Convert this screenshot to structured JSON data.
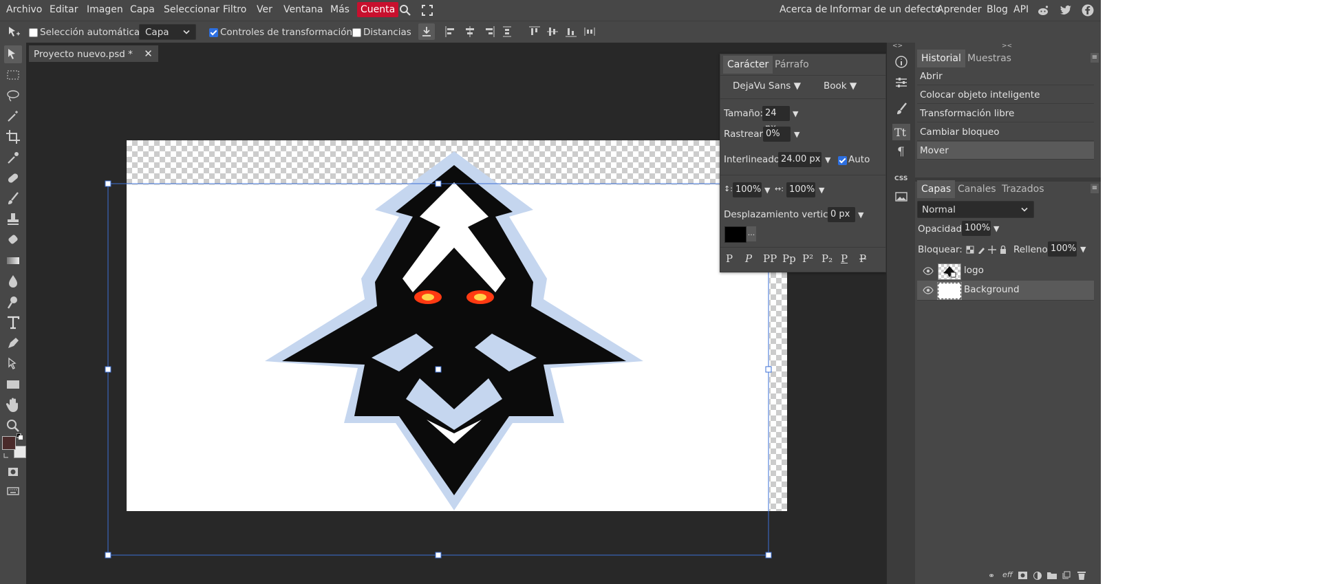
{
  "menubar": {
    "items": [
      "Archivo",
      "Editar",
      "Imagen",
      "Capa",
      "Seleccionar",
      "Filtro",
      "Ver",
      "Ventana",
      "Más",
      "Cuenta"
    ],
    "right_links": [
      "Acerca de",
      "Informar de un defecto",
      "Aprender",
      "Blog",
      "API"
    ],
    "icons": [
      "search-icon",
      "fullscreen-icon",
      "reddit-icon",
      "twitter-icon",
      "facebook-icon"
    ]
  },
  "options": {
    "auto_select_label": "Selección automática",
    "auto_select_checked": false,
    "target_value": "Capa",
    "transform_controls_label": "Controles de transformación",
    "transform_controls_checked": true,
    "distances_label": "Distancias",
    "distances_checked": false
  },
  "document": {
    "tab_title": "Proyecto nuevo.psd *"
  },
  "character_panel": {
    "tabs": [
      "Carácter",
      "Párrafo"
    ],
    "font_family": "DejaVu Sans",
    "font_style": "Book",
    "size_label": "Tamaño:",
    "size_value": "24 px",
    "tracking_label": "Rastrear:",
    "tracking_value": "0%",
    "leading_label": "Interlineado:",
    "leading_value": "24.00 px",
    "leading_auto_label": "Auto",
    "leading_auto_checked": true,
    "vscale_value": "100%",
    "hscale_value": "100%",
    "baseline_label": "Desplazamiento vertical:",
    "baseline_value": "0 px",
    "more_label": "...",
    "color": "#000000",
    "style_buttons": [
      "P",
      "P",
      "PP",
      "Pp",
      "P²",
      "P₂",
      "P",
      "P"
    ]
  },
  "history_panel": {
    "tabs": [
      "Historial",
      "Muestras"
    ],
    "items": [
      "Abrir",
      "Colocar objeto inteligente",
      "Transformación libre",
      "Cambiar bloqueo",
      "Mover"
    ],
    "selected_index": 4
  },
  "layers_panel": {
    "tabs": [
      "Capas",
      "Canales",
      "Trazados"
    ],
    "blend_mode": "Normal",
    "opacity_label": "Opacidad:",
    "opacity_value": "100%",
    "lock_label": "Bloquear:",
    "fill_label": "Relleno:",
    "fill_value": "100%",
    "layers": [
      {
        "name": "logo",
        "visible": true,
        "selected": false
      },
      {
        "name": "Background",
        "visible": true,
        "selected": true
      }
    ]
  },
  "colors": {
    "accent": "#c8102e",
    "foreground": "#4a2a2a",
    "background": "#e8e8e8",
    "selection": "#3b6fd6"
  }
}
